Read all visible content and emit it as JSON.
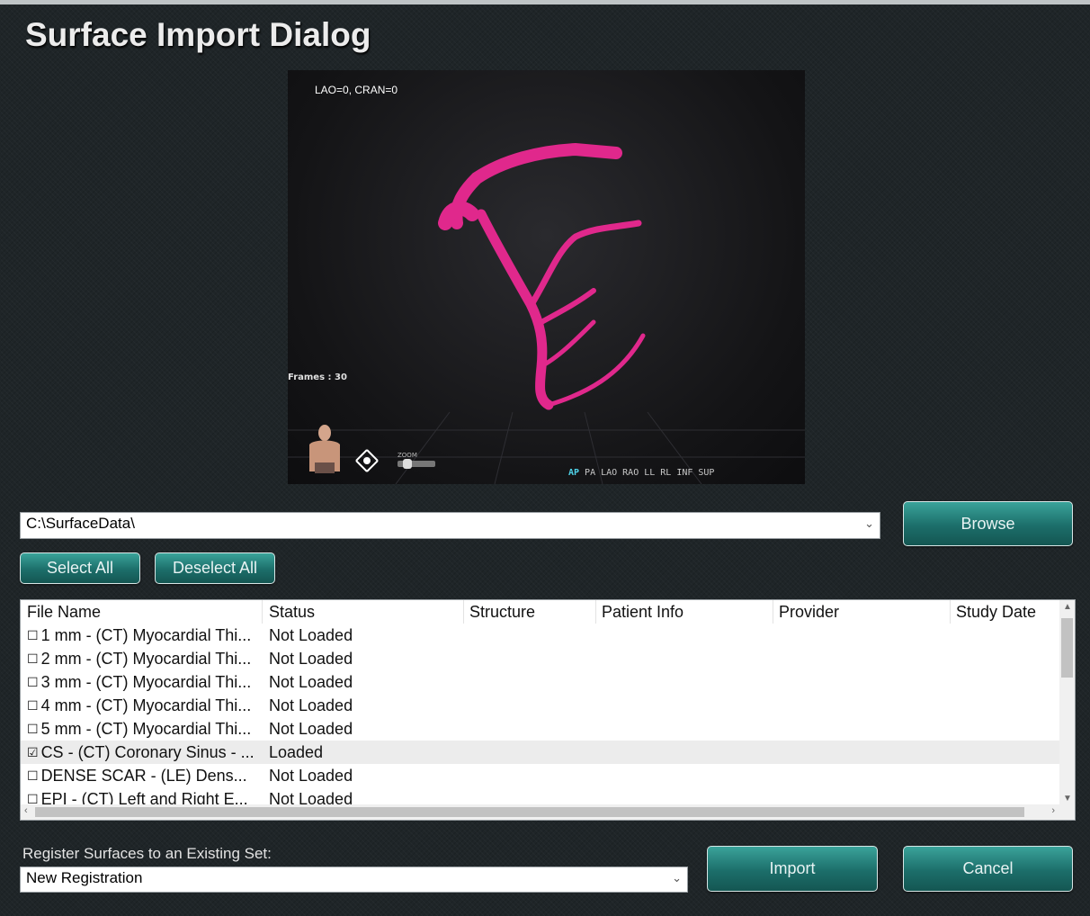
{
  "window": {
    "title": "Surface Import Dialog"
  },
  "viewer": {
    "view_angle": "LAO=0, CRAN=0",
    "frames": "Frames : 30",
    "zoom_label": "ZOOM",
    "view_buttons": [
      "AP",
      "PA",
      "LAO",
      "RAO",
      "LL",
      "RL",
      "INF",
      "SUP"
    ],
    "active_view": "AP",
    "model_color": "#e0288c"
  },
  "path": {
    "value": "C:\\SurfaceData\\"
  },
  "buttons": {
    "browse": "Browse",
    "select_all": "Select All",
    "deselect_all": "Deselect All",
    "import": "Import",
    "cancel": "Cancel"
  },
  "table": {
    "columns": [
      "File Name",
      "Status",
      "Structure",
      "Patient Info",
      "Provider",
      "Study Date"
    ],
    "rows": [
      {
        "checked": false,
        "file": "1 mm - (CT) Myocardial Thi...",
        "status": "Not Loaded"
      },
      {
        "checked": false,
        "file": "2 mm - (CT) Myocardial Thi...",
        "status": "Not Loaded"
      },
      {
        "checked": false,
        "file": "3 mm - (CT) Myocardial Thi...",
        "status": "Not Loaded"
      },
      {
        "checked": false,
        "file": "4 mm - (CT) Myocardial Thi...",
        "status": "Not Loaded"
      },
      {
        "checked": false,
        "file": "5 mm - (CT) Myocardial Thi...",
        "status": "Not Loaded"
      },
      {
        "checked": true,
        "file": "CS - (CT) Coronary Sinus - ...",
        "status": "Loaded"
      },
      {
        "checked": false,
        "file": "DENSE SCAR - (LE) Dens...",
        "status": "Not Loaded"
      },
      {
        "checked": false,
        "file": "EPI - (CT) Left and Right E...",
        "status": "Not Loaded"
      }
    ]
  },
  "registration": {
    "label": "Register Surfaces to an Existing Set:",
    "value": "New Registration"
  },
  "colors": {
    "accent": "#1c6e6a",
    "background": "#1f2528"
  }
}
